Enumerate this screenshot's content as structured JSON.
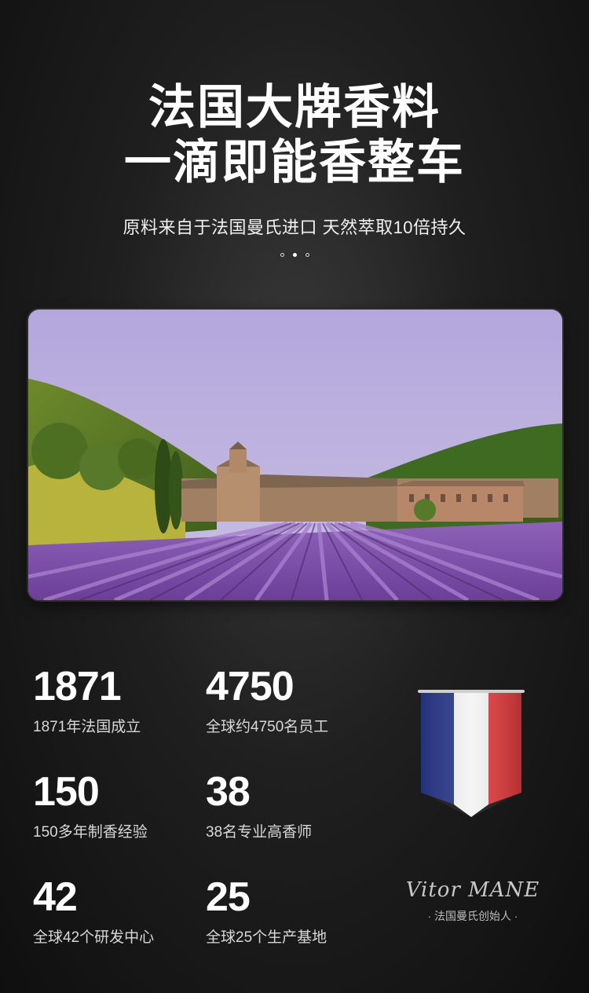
{
  "hero": {
    "title_line1": "法国大牌香料",
    "title_line2": "一滴即能香整车",
    "subtitle": "原料来自于法国曼氏进口 天然萃取10倍持久",
    "carousel_dots": 3,
    "active_dot": 1
  },
  "stats": [
    {
      "number": "1871",
      "label": "1871年法国成立"
    },
    {
      "number": "4750",
      "label": "全球约4750名员工"
    },
    {
      "number": "150",
      "label": "150多年制香经验"
    },
    {
      "number": "38",
      "label": "38名专业高香师"
    },
    {
      "number": "42",
      "label": "全球42个研发中心"
    },
    {
      "number": "25",
      "label": "全球25个生产基地"
    }
  ],
  "founder": {
    "signature": "Vitor MANE",
    "caption": "· 法国曼氏创始人 ·"
  },
  "colors": {
    "flag_blue": "#2b3a8f",
    "flag_white": "#f4f4f4",
    "flag_red": "#e03a3e",
    "lavender": "#7e4fa8"
  }
}
